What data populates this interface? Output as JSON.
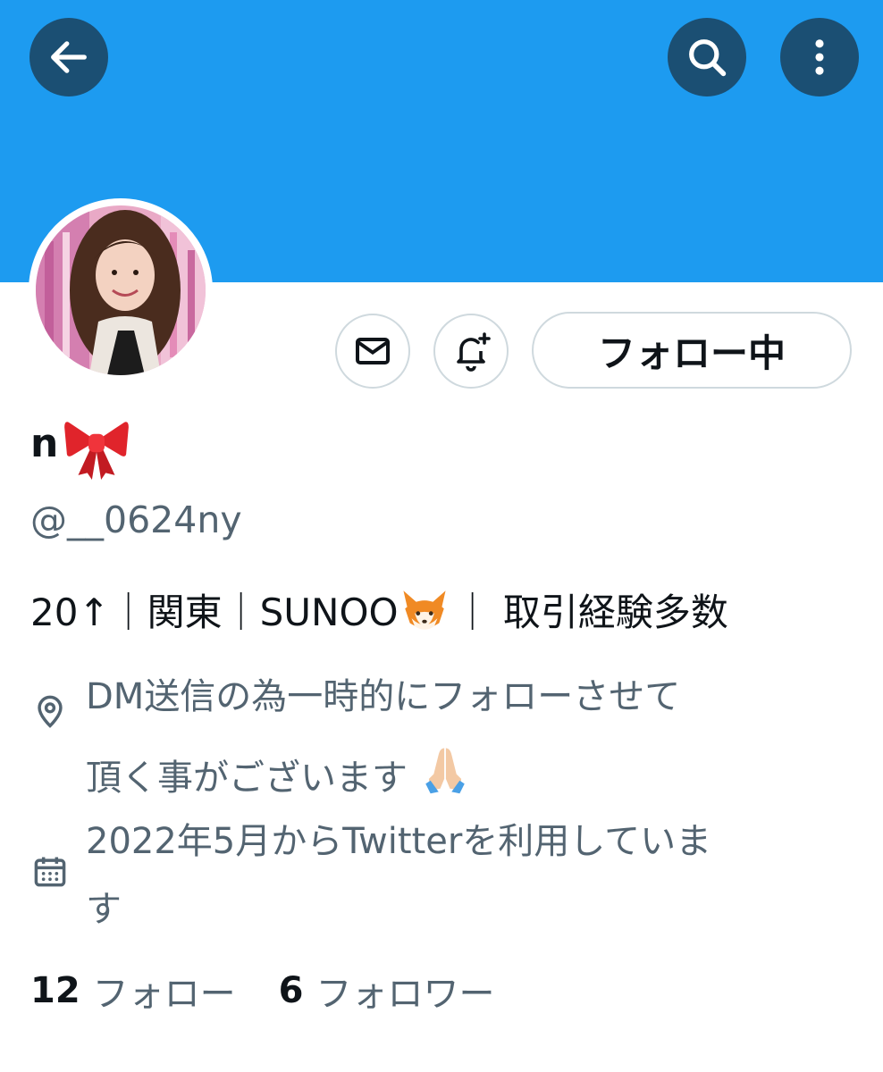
{
  "colors": {
    "banner": "#1d9bf0",
    "header_button": "#1b4f73",
    "secondary_text": "#536471",
    "primary_text": "#0f1419",
    "button_border": "#cfd9de"
  },
  "header": {
    "back_icon": "arrow-left-icon",
    "search_icon": "search-icon",
    "more_icon": "more-vertical-icon"
  },
  "profile": {
    "avatar_icon": "profile-photo",
    "display_name": "n",
    "display_name_emoji": "ribbon-emoji",
    "handle": "@__0624ny",
    "bio": "20↑｜関東｜SUNOO",
    "bio_emoji": "fox-emoji",
    "bio_tail": "｜ 取引経験多数",
    "location_line1": "DM送信の為一時的にフォローさせて",
    "location_line2": "頂く事がございます",
    "location_emoji": "folded-hands-emoji",
    "joined_line1": "2022年5月からTwitterを利用していま",
    "joined_line2": "す"
  },
  "actions": {
    "message_icon": "envelope-icon",
    "notify_icon": "bell-plus-icon",
    "follow_label": "フォロー中"
  },
  "stats": {
    "following_count": "12",
    "following_label": "フォロー",
    "followers_count": "6",
    "followers_label": "フォロワー"
  }
}
